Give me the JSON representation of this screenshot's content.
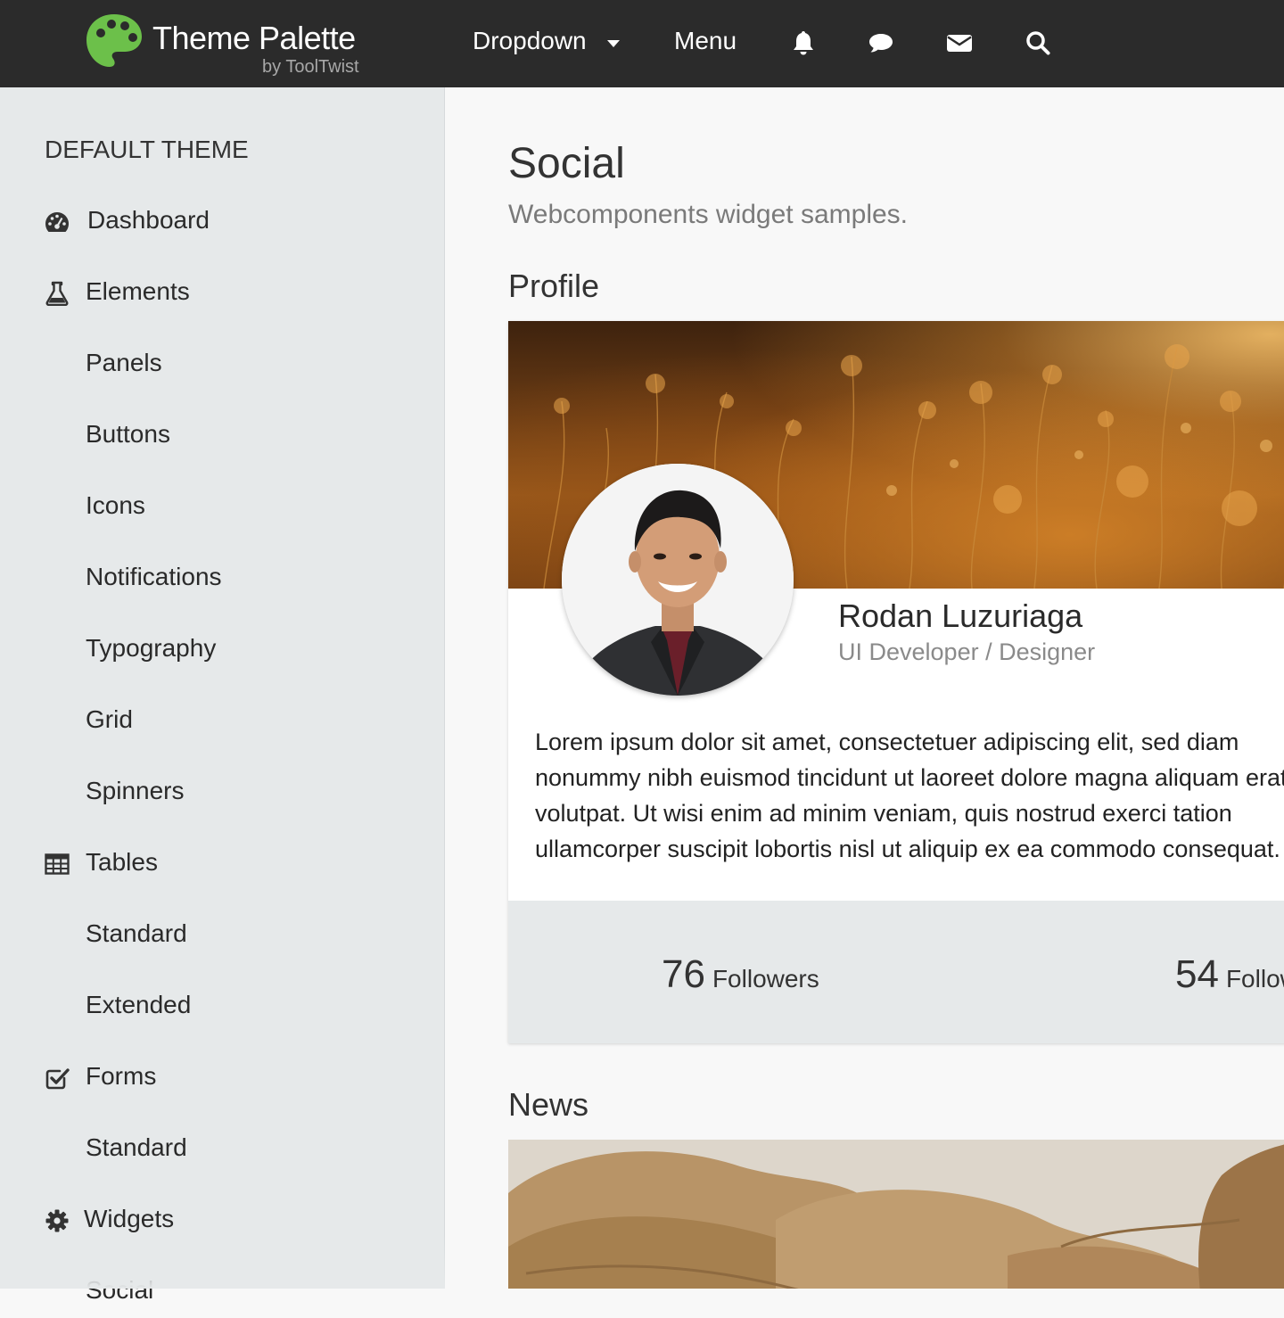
{
  "brand": {
    "title": "Theme Palette",
    "subtitle": "by ToolTwist",
    "logo_icon": "palette-icon",
    "logo_color": "#6cc04a"
  },
  "navbar": {
    "dropdown_label": "Dropdown",
    "menu_label": "Menu",
    "icons": [
      "bell-icon",
      "comment-icon",
      "envelope-icon",
      "search-icon"
    ],
    "background": "#2b2b2b"
  },
  "sidebar": {
    "heading": "DEFAULT THEME",
    "items": [
      {
        "label": "Dashboard",
        "icon": "dashboard-icon"
      },
      {
        "label": "Elements",
        "icon": "flask-icon"
      },
      {
        "label": "Panels"
      },
      {
        "label": "Buttons"
      },
      {
        "label": "Icons"
      },
      {
        "label": "Notifications"
      },
      {
        "label": "Typography"
      },
      {
        "label": "Grid"
      },
      {
        "label": "Spinners"
      },
      {
        "label": "Tables",
        "icon": "table-icon"
      },
      {
        "label": "Standard"
      },
      {
        "label": "Extended"
      },
      {
        "label": "Forms",
        "icon": "check-square-icon"
      },
      {
        "label": "Standard"
      },
      {
        "label": "Widgets",
        "icon": "gear-icon"
      },
      {
        "label": "Social"
      }
    ]
  },
  "page": {
    "title": "Social",
    "subtitle": "Webcomponents widget samples."
  },
  "profile": {
    "heading": "Profile",
    "name": "Rodan Luzuriaga",
    "role": "UI Developer / Designer",
    "bio": "Lorem ipsum dolor sit amet, consectetuer adipiscing elit, sed diam nonummy nibh euismod tincidunt ut laoreet dolore magna aliquam erat volutpat. Ut wisi enim ad minim veniam, quis nostrud exerci tation ullamcorper suscipit lobortis nisl ut aliquip ex ea commodo consequat.",
    "stats": [
      {
        "count": "76",
        "label": "Followers"
      },
      {
        "count": "54",
        "label": "Following"
      }
    ]
  },
  "news": {
    "heading": "News"
  }
}
